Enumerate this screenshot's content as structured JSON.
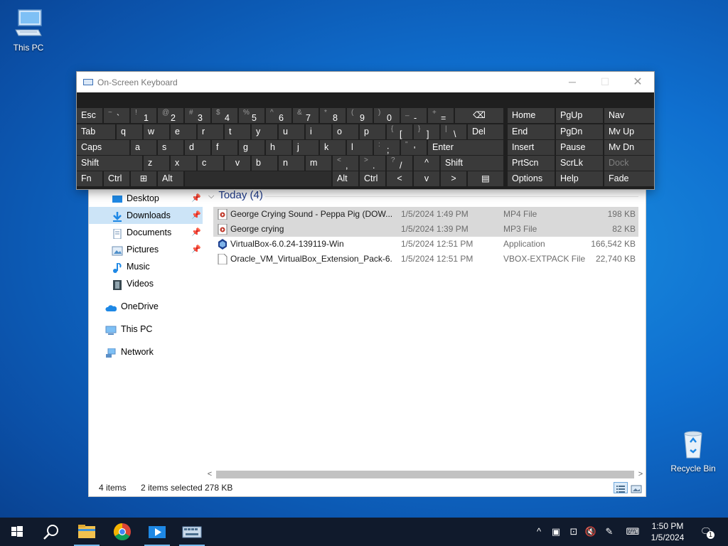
{
  "desktop": {
    "icons": [
      {
        "label": "This PC"
      },
      {
        "label": "Recycle Bin"
      }
    ]
  },
  "osk": {
    "title": "On-Screen Keyboard",
    "rows": [
      [
        {
          "label": "Esc"
        },
        {
          "shift": "~",
          "main": "`"
        },
        {
          "shift": "!",
          "main": "1"
        },
        {
          "shift": "@",
          "main": "2"
        },
        {
          "shift": "#",
          "main": "3"
        },
        {
          "shift": "$",
          "main": "4"
        },
        {
          "shift": "%",
          "main": "5"
        },
        {
          "shift": "^",
          "main": "6"
        },
        {
          "shift": "&",
          "main": "7"
        },
        {
          "shift": "*",
          "main": "8"
        },
        {
          "shift": "(",
          "main": "9"
        },
        {
          "shift": ")",
          "main": "0"
        },
        {
          "shift": "_",
          "main": "-"
        },
        {
          "shift": "+",
          "main": "="
        },
        {
          "label": "⌫"
        }
      ],
      [
        {
          "label": "Tab"
        },
        {
          "label": "q"
        },
        {
          "label": "w"
        },
        {
          "label": "e"
        },
        {
          "label": "r"
        },
        {
          "label": "t"
        },
        {
          "label": "y"
        },
        {
          "label": "u"
        },
        {
          "label": "i"
        },
        {
          "label": "o"
        },
        {
          "label": "p"
        },
        {
          "shift": "{",
          "main": "["
        },
        {
          "shift": "}",
          "main": "]"
        },
        {
          "shift": "|",
          "main": "\\"
        },
        {
          "label": "Del"
        }
      ],
      [
        {
          "label": "Caps"
        },
        {
          "label": "a"
        },
        {
          "label": "s"
        },
        {
          "label": "d"
        },
        {
          "label": "f"
        },
        {
          "label": "g"
        },
        {
          "label": "h"
        },
        {
          "label": "j"
        },
        {
          "label": "k"
        },
        {
          "label": "l"
        },
        {
          "shift": ":",
          "main": ";"
        },
        {
          "shift": "\"",
          "main": "'"
        },
        {
          "label": "Enter"
        }
      ],
      [
        {
          "label": "Shift"
        },
        {
          "label": "z"
        },
        {
          "label": "x"
        },
        {
          "label": "c"
        },
        {
          "label": "v"
        },
        {
          "label": "b"
        },
        {
          "label": "n"
        },
        {
          "label": "m"
        },
        {
          "shift": "<",
          "main": ","
        },
        {
          "shift": ">",
          "main": "."
        },
        {
          "shift": "?",
          "main": "/"
        },
        {
          "label": "^"
        },
        {
          "label": "Shift"
        }
      ],
      [
        {
          "label": "Fn"
        },
        {
          "label": "Ctrl"
        },
        {
          "label": "⊞"
        },
        {
          "label": "Alt"
        },
        {
          "label": ""
        },
        {
          "label": "Alt"
        },
        {
          "label": "Ctrl"
        },
        {
          "label": "<"
        },
        {
          "label": "v"
        },
        {
          "label": ">"
        },
        {
          "label": "▤"
        }
      ]
    ],
    "nav_rows": [
      [
        "Home",
        "PgUp",
        "Nav"
      ],
      [
        "End",
        "PgDn",
        "Mv Up"
      ],
      [
        "Insert",
        "Pause",
        "Mv Dn"
      ],
      [
        "PrtScn",
        "ScrLk",
        "Dock"
      ],
      [
        "Options",
        "Help",
        "Fade"
      ]
    ]
  },
  "explorer": {
    "nav_items": [
      {
        "label": "Desktop",
        "pinned": true
      },
      {
        "label": "Downloads",
        "pinned": true,
        "selected": true
      },
      {
        "label": "Documents",
        "pinned": true
      },
      {
        "label": "Pictures",
        "pinned": true
      },
      {
        "label": "Music"
      },
      {
        "label": "Videos"
      },
      {
        "label": "OneDrive"
      },
      {
        "label": "This PC"
      },
      {
        "label": "Network"
      }
    ],
    "group_header": "Today (4)",
    "files": [
      {
        "name": "George Crying Sound -  Peppa Pig (DOW...",
        "date": "1/5/2024 1:49 PM",
        "type": "MP4 File",
        "size": "198 KB",
        "selected": true
      },
      {
        "name": "George crying",
        "date": "1/5/2024 1:39 PM",
        "type": "MP3 File",
        "size": "82 KB",
        "selected": true
      },
      {
        "name": "VirtualBox-6.0.24-139119-Win",
        "date": "1/5/2024 12:51 PM",
        "type": "Application",
        "size": "166,542 KB",
        "selected": false
      },
      {
        "name": "Oracle_VM_VirtualBox_Extension_Pack-6....",
        "date": "1/5/2024 12:51 PM",
        "type": "VBOX-EXTPACK File",
        "size": "22,740 KB",
        "selected": false
      }
    ],
    "status": {
      "items": "4 items",
      "selected": "2 items selected",
      "size": "278 KB"
    }
  },
  "taskbar": {
    "clock_time": "1:50 PM",
    "clock_date": "1/5/2024",
    "notifications": "1"
  }
}
